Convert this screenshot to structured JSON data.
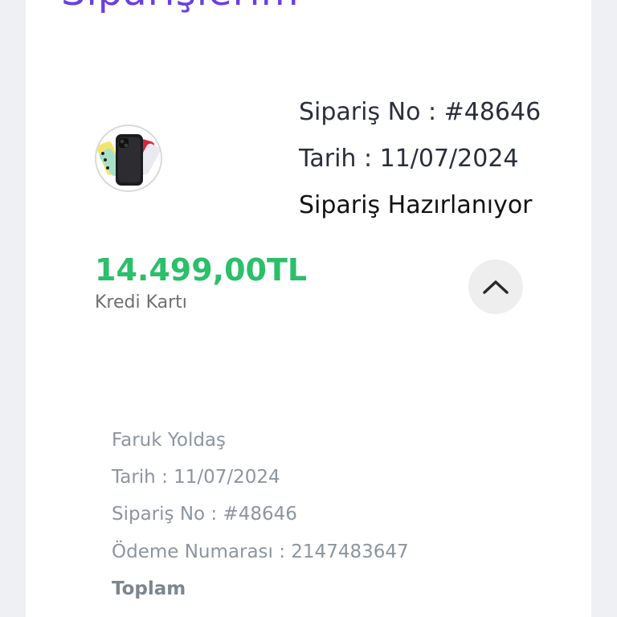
{
  "header": {
    "title": "Siparişlerim"
  },
  "order": {
    "order_no": "Sipariş No : #48646",
    "date": "Tarih : 11/07/2024",
    "status": "Sipariş Hazırlanıyor",
    "price": "14.499,00TL",
    "payment_method": "Kredi Kartı",
    "thumbnail_icon": "phone-product-image",
    "toggle_icon": "chevron-up-icon"
  },
  "details": {
    "customer_name": "Faruk Yoldaş",
    "date": "Tarih : 11/07/2024",
    "order_no": "Sipariş No : #48646",
    "payment_number": "Ödeme Numarası : 2147483647",
    "total_label": "Toplam"
  },
  "colors": {
    "title": "#6a3ee6",
    "price": "#2bbf6b",
    "details_text": "#8c959e"
  }
}
